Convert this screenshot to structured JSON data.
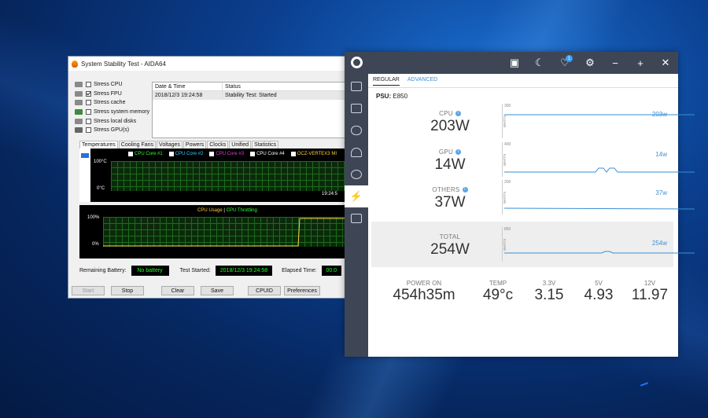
{
  "aida": {
    "title": "System Stability Test - AIDA64",
    "stress_items": [
      {
        "label": "Stress CPU",
        "checked": false
      },
      {
        "label": "Stress FPU",
        "checked": true
      },
      {
        "label": "Stress cache",
        "checked": false
      },
      {
        "label": "Stress system memory",
        "checked": false
      },
      {
        "label": "Stress local disks",
        "checked": false
      },
      {
        "label": "Stress GPU(s)",
        "checked": false
      }
    ],
    "log_headers": {
      "date": "Date & Time",
      "status": "Status"
    },
    "log_rows": [
      {
        "date": "2018/12/3 19:24:58",
        "status": "Stability Test: Started"
      }
    ],
    "tabs": [
      "Temperatures",
      "Cooling Fans",
      "Voltages",
      "Powers",
      "Clocks",
      "Unified",
      "Statistics"
    ],
    "temp_legend": [
      "CPU Core #1",
      "CPU Core #2",
      "CPU Core #3",
      "CPU Core #4",
      "OCZ-VERTEX3 MI"
    ],
    "temp_axis_top": "100°C",
    "temp_axis_bottom": "0°C",
    "temp_time": "19:24:5",
    "usage_legend_a": "CPU Usage",
    "usage_sep": "|",
    "usage_legend_b": "CPU Throttling",
    "usage_axis_top": "100%",
    "usage_axis_bottom": "0%",
    "remaining_battery_label": "Remaining Battery:",
    "remaining_battery_value": "No battery",
    "test_started_label": "Test Started:",
    "test_started_value": "2018/12/3 19:24:58",
    "elapsed_label": "Elapsed Time:",
    "elapsed_value": "00:0",
    "buttons": {
      "start": "Start",
      "stop": "Stop",
      "clear": "Clear",
      "save": "Save",
      "cpuid": "CPUID",
      "prefs": "Preferences"
    }
  },
  "icue": {
    "notification_count": "1",
    "tabs": [
      "REGULAR",
      "ADVANCED"
    ],
    "psu_label": "PSU:",
    "psu_model": "E850",
    "rails": [
      {
        "label": "CPU",
        "value": "203W",
        "graph_max": "300",
        "graph_value": "203w",
        "info": true
      },
      {
        "label": "GPU",
        "value": "14W",
        "graph_max": "400",
        "graph_value": "14w",
        "info": true
      },
      {
        "label": "OTHERS",
        "value": "37W",
        "graph_max": "200",
        "graph_value": "37w",
        "info": true
      },
      {
        "label": "TOTAL",
        "value": "254W",
        "graph_max": "850",
        "graph_value": "254w",
        "info": false
      }
    ],
    "watts_label": "WATTS",
    "stats": [
      {
        "label": "POWER ON",
        "value": "454h35m"
      },
      {
        "label": "TEMP",
        "value": "49°c"
      },
      {
        "label": "3.3V",
        "value": "3.15"
      },
      {
        "label": "5V",
        "value": "4.93"
      },
      {
        "label": "12V",
        "value": "11.97"
      }
    ]
  },
  "colors": {
    "accent": "#3a8fd6",
    "sidebar": "#3e4656",
    "graph_green": "#22ff22"
  }
}
